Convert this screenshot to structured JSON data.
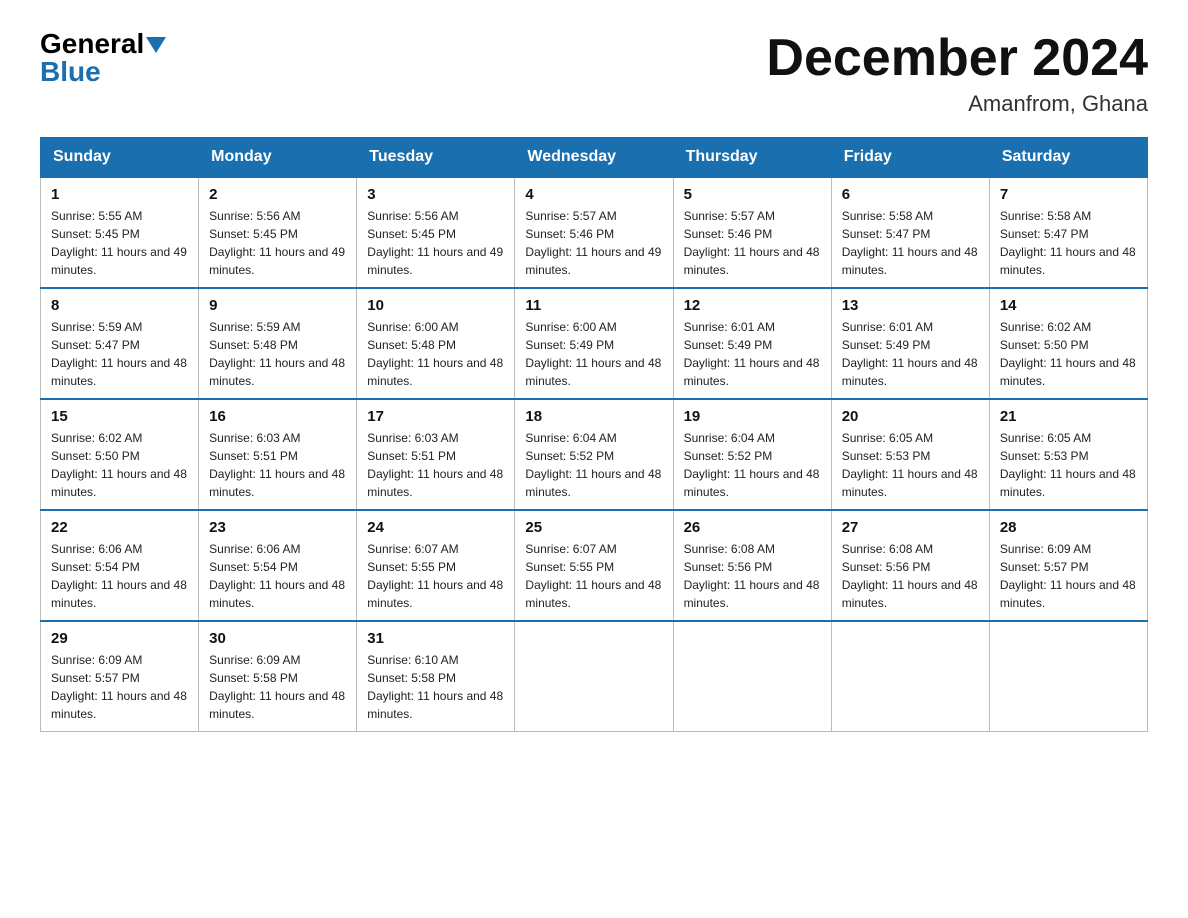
{
  "header": {
    "logo_general": "General",
    "logo_blue": "Blue",
    "month_title": "December 2024",
    "location": "Amanfrom, Ghana"
  },
  "days_of_week": [
    "Sunday",
    "Monday",
    "Tuesday",
    "Wednesday",
    "Thursday",
    "Friday",
    "Saturday"
  ],
  "weeks": [
    [
      {
        "day": "1",
        "sunrise": "5:55 AM",
        "sunset": "5:45 PM",
        "daylight": "11 hours and 49 minutes."
      },
      {
        "day": "2",
        "sunrise": "5:56 AM",
        "sunset": "5:45 PM",
        "daylight": "11 hours and 49 minutes."
      },
      {
        "day": "3",
        "sunrise": "5:56 AM",
        "sunset": "5:45 PM",
        "daylight": "11 hours and 49 minutes."
      },
      {
        "day": "4",
        "sunrise": "5:57 AM",
        "sunset": "5:46 PM",
        "daylight": "11 hours and 49 minutes."
      },
      {
        "day": "5",
        "sunrise": "5:57 AM",
        "sunset": "5:46 PM",
        "daylight": "11 hours and 48 minutes."
      },
      {
        "day": "6",
        "sunrise": "5:58 AM",
        "sunset": "5:47 PM",
        "daylight": "11 hours and 48 minutes."
      },
      {
        "day": "7",
        "sunrise": "5:58 AM",
        "sunset": "5:47 PM",
        "daylight": "11 hours and 48 minutes."
      }
    ],
    [
      {
        "day": "8",
        "sunrise": "5:59 AM",
        "sunset": "5:47 PM",
        "daylight": "11 hours and 48 minutes."
      },
      {
        "day": "9",
        "sunrise": "5:59 AM",
        "sunset": "5:48 PM",
        "daylight": "11 hours and 48 minutes."
      },
      {
        "day": "10",
        "sunrise": "6:00 AM",
        "sunset": "5:48 PM",
        "daylight": "11 hours and 48 minutes."
      },
      {
        "day": "11",
        "sunrise": "6:00 AM",
        "sunset": "5:49 PM",
        "daylight": "11 hours and 48 minutes."
      },
      {
        "day": "12",
        "sunrise": "6:01 AM",
        "sunset": "5:49 PM",
        "daylight": "11 hours and 48 minutes."
      },
      {
        "day": "13",
        "sunrise": "6:01 AM",
        "sunset": "5:49 PM",
        "daylight": "11 hours and 48 minutes."
      },
      {
        "day": "14",
        "sunrise": "6:02 AM",
        "sunset": "5:50 PM",
        "daylight": "11 hours and 48 minutes."
      }
    ],
    [
      {
        "day": "15",
        "sunrise": "6:02 AM",
        "sunset": "5:50 PM",
        "daylight": "11 hours and 48 minutes."
      },
      {
        "day": "16",
        "sunrise": "6:03 AM",
        "sunset": "5:51 PM",
        "daylight": "11 hours and 48 minutes."
      },
      {
        "day": "17",
        "sunrise": "6:03 AM",
        "sunset": "5:51 PM",
        "daylight": "11 hours and 48 minutes."
      },
      {
        "day": "18",
        "sunrise": "6:04 AM",
        "sunset": "5:52 PM",
        "daylight": "11 hours and 48 minutes."
      },
      {
        "day": "19",
        "sunrise": "6:04 AM",
        "sunset": "5:52 PM",
        "daylight": "11 hours and 48 minutes."
      },
      {
        "day": "20",
        "sunrise": "6:05 AM",
        "sunset": "5:53 PM",
        "daylight": "11 hours and 48 minutes."
      },
      {
        "day": "21",
        "sunrise": "6:05 AM",
        "sunset": "5:53 PM",
        "daylight": "11 hours and 48 minutes."
      }
    ],
    [
      {
        "day": "22",
        "sunrise": "6:06 AM",
        "sunset": "5:54 PM",
        "daylight": "11 hours and 48 minutes."
      },
      {
        "day": "23",
        "sunrise": "6:06 AM",
        "sunset": "5:54 PM",
        "daylight": "11 hours and 48 minutes."
      },
      {
        "day": "24",
        "sunrise": "6:07 AM",
        "sunset": "5:55 PM",
        "daylight": "11 hours and 48 minutes."
      },
      {
        "day": "25",
        "sunrise": "6:07 AM",
        "sunset": "5:55 PM",
        "daylight": "11 hours and 48 minutes."
      },
      {
        "day": "26",
        "sunrise": "6:08 AM",
        "sunset": "5:56 PM",
        "daylight": "11 hours and 48 minutes."
      },
      {
        "day": "27",
        "sunrise": "6:08 AM",
        "sunset": "5:56 PM",
        "daylight": "11 hours and 48 minutes."
      },
      {
        "day": "28",
        "sunrise": "6:09 AM",
        "sunset": "5:57 PM",
        "daylight": "11 hours and 48 minutes."
      }
    ],
    [
      {
        "day": "29",
        "sunrise": "6:09 AM",
        "sunset": "5:57 PM",
        "daylight": "11 hours and 48 minutes."
      },
      {
        "day": "30",
        "sunrise": "6:09 AM",
        "sunset": "5:58 PM",
        "daylight": "11 hours and 48 minutes."
      },
      {
        "day": "31",
        "sunrise": "6:10 AM",
        "sunset": "5:58 PM",
        "daylight": "11 hours and 48 minutes."
      },
      null,
      null,
      null,
      null
    ]
  ]
}
